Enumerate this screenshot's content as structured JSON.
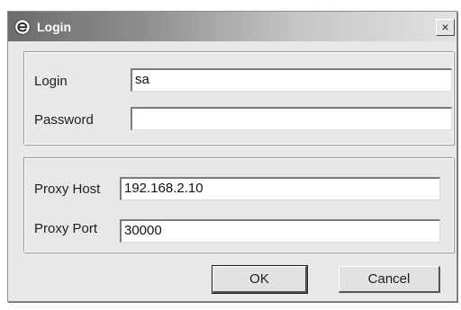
{
  "window": {
    "title": "Login",
    "close_label": "×",
    "icon": "e-logo-icon"
  },
  "login_group": {
    "login_label": "Login",
    "login_value": "sa",
    "password_label": "Password",
    "password_value": ""
  },
  "proxy_group": {
    "host_label": "Proxy Host",
    "host_value": "192.168.2.10",
    "port_label": "Proxy Port",
    "port_value": "30000"
  },
  "buttons": {
    "ok_label": "OK",
    "cancel_label": "Cancel"
  }
}
